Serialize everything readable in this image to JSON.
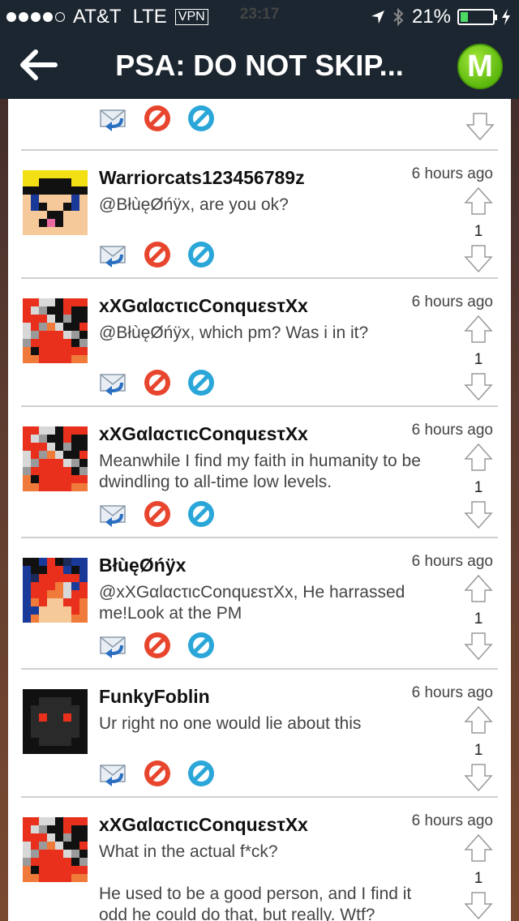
{
  "status": {
    "carrier": "AT&T",
    "network": "LTE",
    "vpn": "VPN",
    "time": "23:17",
    "battery_pct": "21%",
    "battery_level": 0.21
  },
  "nav": {
    "title": "PSA: DO NOT SKIP...",
    "logo_letter": "M"
  },
  "posts": [
    {
      "username": "Warriorcats123456789z",
      "time": "6 hours ago",
      "message": "@BłùęØńÿx, are you ok?",
      "score": "1"
    },
    {
      "username": "xXGαlαcτιcConquεsτXx",
      "time": "6 hours ago",
      "message": "@BłùęØńÿx, which pm? Was i in it?",
      "score": "1"
    },
    {
      "username": "xXGαlαcτιcConquεsτXx",
      "time": "6 hours ago",
      "message": "Meanwhile I find my faith in humanity to be dwindling to all-time low levels.",
      "score": "1"
    },
    {
      "username": "BłùęØńÿx",
      "time": "6 hours ago",
      "message": "@xXGαlαcτιcConquεsτXx, He harrassed me!Look at the PM",
      "score": "1"
    },
    {
      "username": "FunkyFoblin",
      "time": "6 hours ago",
      "message": "Ur right no one would lie about this",
      "score": "1"
    },
    {
      "username": "xXGαlαcτιcConquεsτXx",
      "time": "6 hours ago",
      "message": "What in the actual f*ck?",
      "message2": "He used to be a good person, and I find it odd he could do that, but really. Wtf?",
      "score": "1"
    }
  ],
  "colors": {
    "nav_bg": "#1c2630",
    "logo_green": "#6cc51a",
    "block_red": "#e8452e",
    "block_blue": "#2aa7d8"
  }
}
